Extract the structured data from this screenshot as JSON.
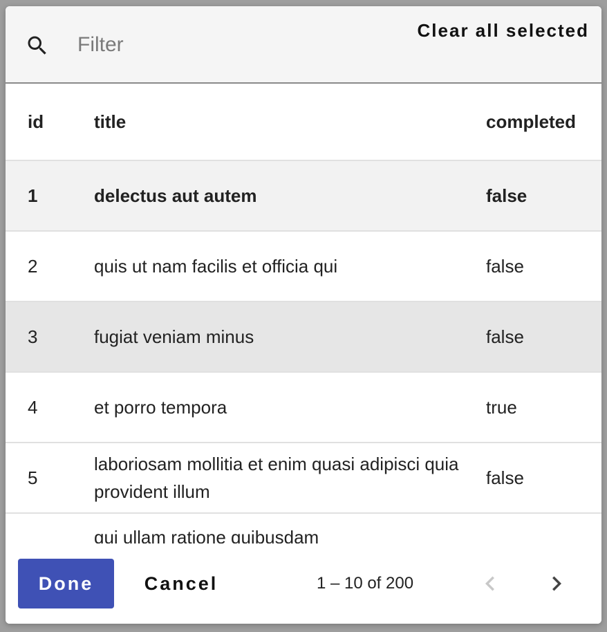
{
  "header": {
    "filter_placeholder": "Filter",
    "filter_value": "",
    "clear_all_label": "Clear all selected",
    "search_icon": "search-icon"
  },
  "table": {
    "columns": [
      "id",
      "title",
      "completed"
    ],
    "rows": [
      {
        "id": "1",
        "title": "delectus aut autem",
        "completed": "false",
        "state": "selected"
      },
      {
        "id": "2",
        "title": "quis ut nam facilis et officia qui",
        "completed": "false",
        "state": "normal"
      },
      {
        "id": "3",
        "title": "fugiat veniam minus",
        "completed": "false",
        "state": "hovered"
      },
      {
        "id": "4",
        "title": "et porro tempora",
        "completed": "true",
        "state": "normal"
      },
      {
        "id": "5",
        "title": "laboriosam mollitia et enim quasi adipisci quia provident illum",
        "completed": "false",
        "state": "normal"
      },
      {
        "id": "",
        "title": "qui ullam ratione quibusdam",
        "completed": "",
        "state": "partially-visible"
      }
    ]
  },
  "footer": {
    "done_label": "Done",
    "cancel_label": "Cancel",
    "range_label": "1 – 10 of 200",
    "prev_icon": "chevron-left-icon",
    "next_icon": "chevron-right-icon"
  },
  "colors": {
    "primary": "#3f51b5",
    "selected_row": "#f2f2f2",
    "hovered_row": "#e6e6e6",
    "header_bg": "#f5f5f5",
    "disabled_icon": "#c8c8c8"
  }
}
